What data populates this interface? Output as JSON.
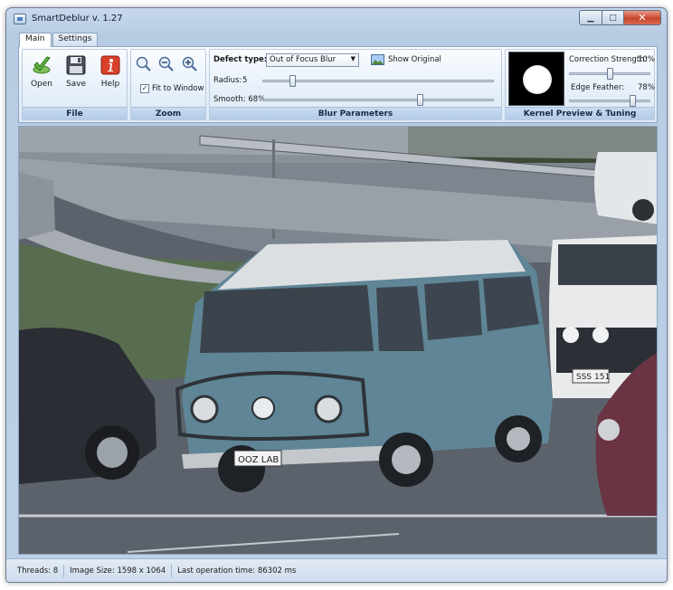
{
  "window": {
    "title": "SmartDeblur v. 1.27"
  },
  "tabs": [
    {
      "label": "Main",
      "active": true
    },
    {
      "label": "Settings",
      "active": false
    }
  ],
  "file_group": {
    "label": "File",
    "buttons": [
      {
        "label": "Open",
        "icon": "open-checkmark-icon"
      },
      {
        "label": "Save",
        "icon": "floppy-disk-icon"
      },
      {
        "label": "Help",
        "icon": "help-info-icon"
      }
    ]
  },
  "zoom_group": {
    "label": "Zoom",
    "icons": [
      "zoom-icon",
      "zoom-out-icon",
      "zoom-in-icon"
    ],
    "fit_to_window": {
      "label": "Fit to Window",
      "checked": true
    }
  },
  "blur_group": {
    "label": "Blur Parameters",
    "defect_type_label": "Defect type:",
    "defect_type_value": "Out of Focus Blur",
    "show_original": "Show Original",
    "radius": {
      "label": "Radius:",
      "value": "5",
      "fraction": 0.13
    },
    "smooth": {
      "label": "Smooth: 68%",
      "fraction": 0.68
    }
  },
  "kernel_group": {
    "label": "Kernel Preview & Tuning",
    "correction_strength": {
      "label": "Correction Strength:",
      "value": "10%",
      "fraction": 0.5
    },
    "edge_feather": {
      "label": "Edge Feather:",
      "value": "78%",
      "fraction": 0.78
    }
  },
  "status": {
    "threads": "Threads: 8",
    "image_size": "Image Size: 1598 x 1064",
    "operation_time": "Last operation time: 86302 ms"
  },
  "plate_van": "OOZ LAB",
  "plate_car": "SSS 151"
}
